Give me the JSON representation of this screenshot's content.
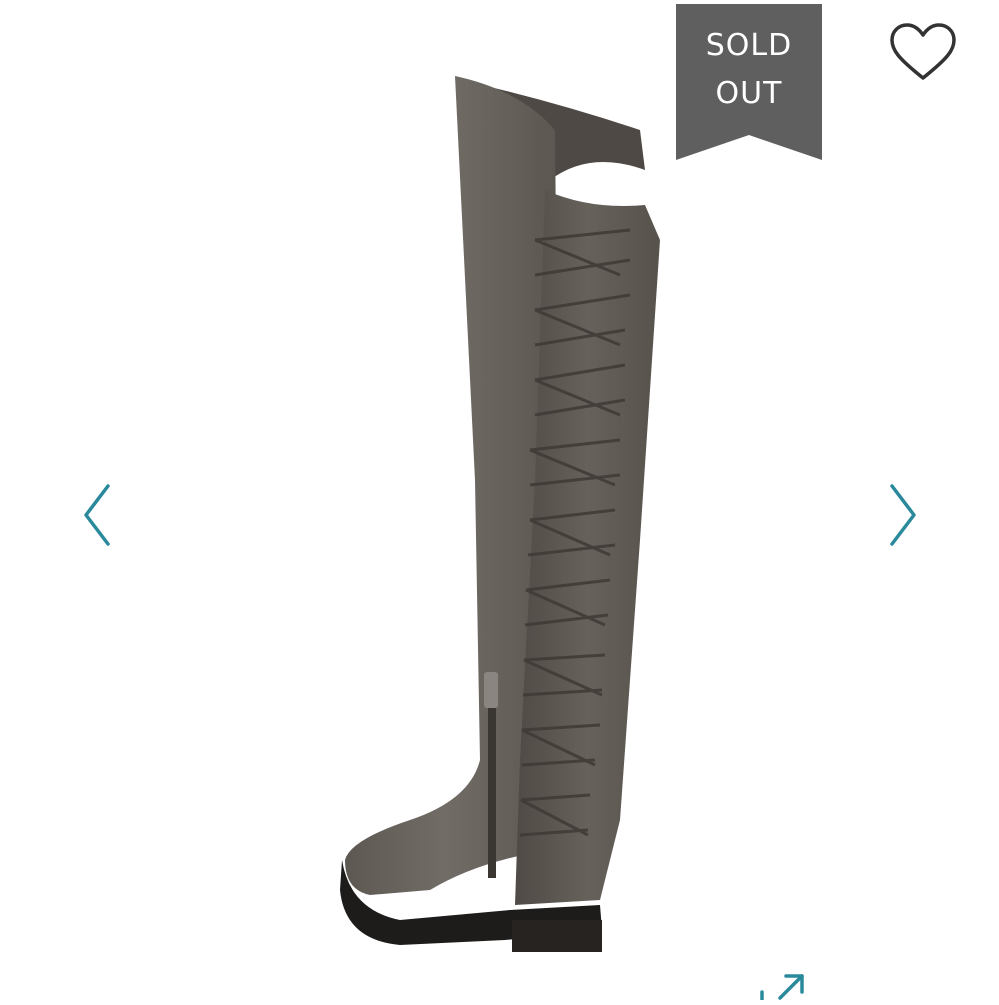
{
  "badge": {
    "line1": "SOLD",
    "line2": "OUT",
    "color": "#5f5f5f"
  },
  "icons": {
    "favorite": "heart-outline-icon",
    "previous": "chevron-left-icon",
    "next": "chevron-right-icon",
    "expand": "expand-arrows-icon"
  },
  "colors": {
    "accent": "#2a8a9c",
    "product": "#6b6560"
  }
}
